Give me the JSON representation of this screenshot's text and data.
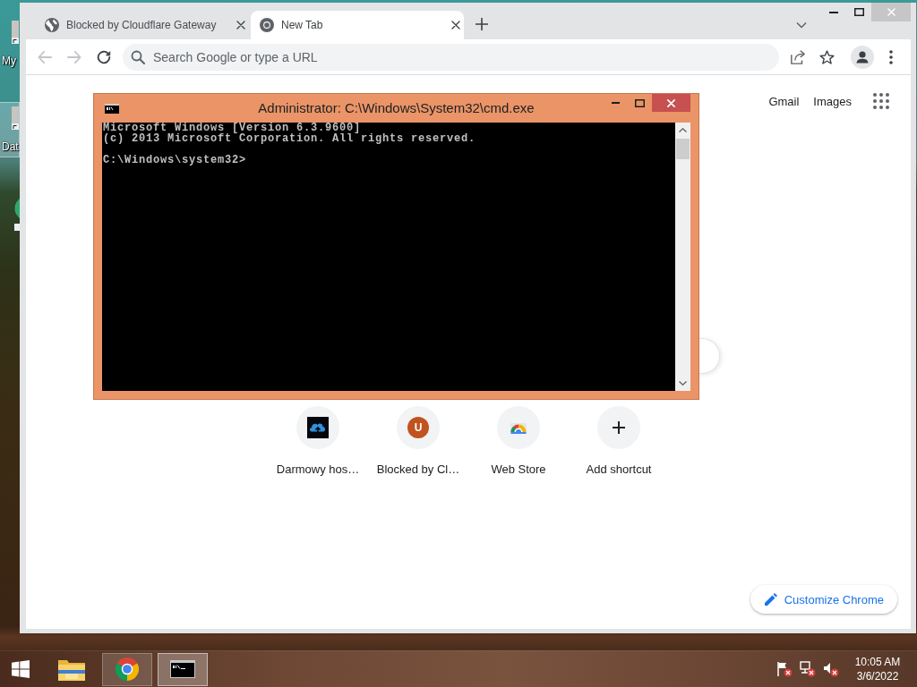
{
  "desktop": {
    "icons": [
      {
        "label": "My",
        "selected": false
      },
      {
        "label": "Dat",
        "selected": true
      }
    ]
  },
  "browser": {
    "tabs": [
      {
        "title": "Blocked by Cloudflare Gateway",
        "kind": "globe",
        "selected": false
      },
      {
        "title": "New Tab",
        "kind": "chrome",
        "selected": true
      }
    ],
    "nav_buttons": [
      {
        "kind": "back",
        "disabled": true
      },
      {
        "kind": "forward",
        "disabled": true
      },
      {
        "kind": "reload",
        "disabled": false
      }
    ],
    "omnibox": {
      "placeholder": "Search Google or type a URL"
    },
    "header_links": [
      "Gmail",
      "Images"
    ],
    "shortcuts": [
      {
        "kind": "cloud",
        "label": "Darmowy hos…"
      },
      {
        "kind": "letter",
        "letter": "U",
        "label": "Blocked by Cl…"
      },
      {
        "kind": "store",
        "label": "Web Store"
      },
      {
        "kind": "add",
        "label": "Add shortcut"
      }
    ],
    "customize_button": "Customize Chrome"
  },
  "console_window": {
    "title": "Administrator: C:\\Windows\\System32\\cmd.exe",
    "output": [
      "Microsoft Windows [Version 6.3.9600]",
      "(c) 2013 Microsoft Corporation. All rights reserved."
    ],
    "prompt": "C:\\Windows\\system32>"
  },
  "taskbar": {
    "apps": [
      {
        "kind": "explorer",
        "running": false,
        "selected": false
      },
      {
        "kind": "chrome",
        "running": true,
        "selected": false
      },
      {
        "kind": "cmd",
        "running": true,
        "selected": true
      }
    ],
    "time": "10:05 AM",
    "date": "3/6/2022"
  }
}
